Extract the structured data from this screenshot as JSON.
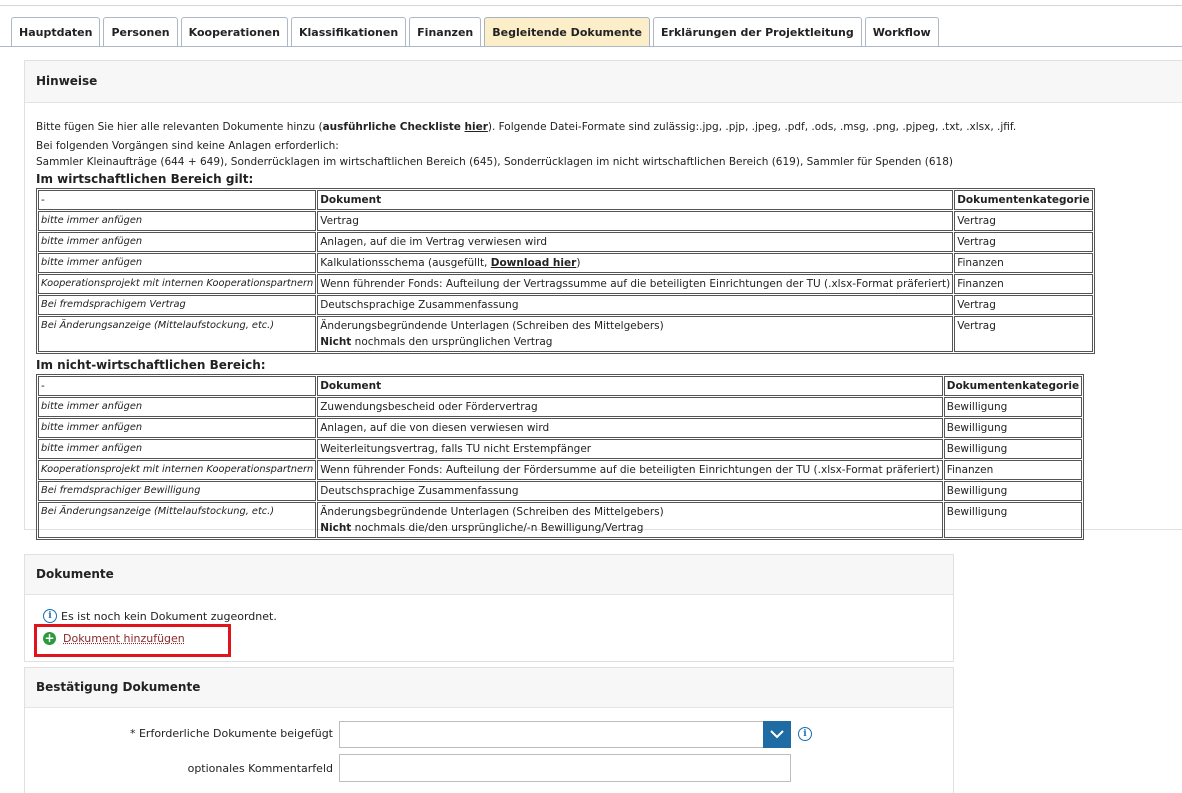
{
  "tabs": [
    {
      "label": "Hauptdaten"
    },
    {
      "label": "Personen"
    },
    {
      "label": "Kooperationen"
    },
    {
      "label": "Klassifikationen"
    },
    {
      "label": "Finanzen"
    },
    {
      "label": "Begleitende Dokumente",
      "active": true
    },
    {
      "label": "Erklärungen der Projektleitung"
    },
    {
      "label": "Workflow"
    }
  ],
  "hinweise": {
    "title": "Hinweise",
    "intro_pre": "Bitte fügen Sie hier alle relevanten Dokumente hinzu (",
    "intro_bold": "ausführliche Checkliste ",
    "intro_link": "hier",
    "intro_post": "). Folgende Datei-Formate sind zulässig:.jpg, .pjp, .jpeg, .pdf, .ods, .msg, .png, .pjpeg, .txt, .xlsx, .jfif.",
    "note_line1": "Bei folgenden Vorgängen sind keine Anlagen erforderlich:",
    "note_line2": "Sammler Kleinaufträge (644 + 649), Sonderrücklagen im wirtschaftlichen Bereich (645), Sonderrücklagen im nicht wirtschaftlichen Bereich (619), Sammler für Spenden (618)",
    "section1_title": "Im wirtschaftlichen Bereich gilt:",
    "section2_title": "Im nicht-wirtschaftlichen Bereich:",
    "table1": {
      "headers": [
        "-",
        "Dokument",
        "Dokumentenkategorie"
      ],
      "rows": [
        {
          "cond": "bitte immer anfügen",
          "doc": "Vertrag",
          "cat": "Vertrag"
        },
        {
          "cond": "bitte immer anfügen",
          "doc": "Anlagen, auf die im Vertrag verwiesen wird",
          "cat": "Vertrag"
        },
        {
          "cond": "bitte immer anfügen",
          "doc_pre": "Kalkulationsschema (ausgefüllt, ",
          "doc_link": "Download hier",
          "doc_post": ")",
          "cat": "Finanzen"
        },
        {
          "cond": "Kooperationsprojekt mit internen  Kooperationspartnern",
          "doc": "Wenn führender Fonds: Aufteilung der Vertragssumme auf die beteiligten Einrichtungen der TU (.xlsx-Format präferiert)",
          "cat": "Finanzen"
        },
        {
          "cond": "Bei fremdsprachigem Vertrag",
          "doc": "Deutschsprachige Zusammenfassung",
          "cat": "Vertrag"
        },
        {
          "cond": "Bei Änderungsanzeige (Mittelaufstockung, etc.)",
          "doc": "Änderungsbegründende Unterlagen (Schreiben des Mittelgebers)",
          "doc2_bold": "Nicht",
          "doc2_rest": " nochmals den ursprünglichen Vertrag",
          "cat": "Vertrag"
        }
      ]
    },
    "table2": {
      "headers": [
        "-",
        "Dokument",
        "Dokumentenkategorie"
      ],
      "rows": [
        {
          "cond": "bitte immer anfügen",
          "doc": "Zuwendungsbescheid oder Fördervertrag",
          "cat": "Bewilligung"
        },
        {
          "cond": "bitte immer anfügen",
          "doc": "Anlagen, auf die von diesen verwiesen wird",
          "cat": "Bewilligung"
        },
        {
          "cond": "bitte immer anfügen",
          "doc": "Weiterleitungsvertrag, falls TU nicht Erstempfänger",
          "cat": "Bewilligung"
        },
        {
          "cond": "Kooperationsprojekt mit internen Kooperationspartnern",
          "doc": "Wenn führender Fonds: Aufteilung der Fördersumme auf die beteiligten Einrichtungen der TU (.xlsx-Format präferiert)",
          "cat": "Finanzen"
        },
        {
          "cond": "Bei fremdsprachiger Bewilligung",
          "doc": "Deutschsprachige Zusammenfassung",
          "cat": "Bewilligung"
        },
        {
          "cond": "Bei Änderungsanzeige (Mittelaufstockung, etc.)",
          "doc": "Änderungsbegründende Unterlagen (Schreiben des Mittelgebers)",
          "doc2_bold": "Nicht",
          "doc2_rest": " nochmals die/den ursprüngliche/-n Bewilligung/Vertrag",
          "cat": "Bewilligung"
        }
      ]
    }
  },
  "dokumente": {
    "title": "Dokumente",
    "empty_message": "Es ist noch kein Dokument zugeordnet.",
    "add_label": "Dokument hinzufügen",
    "highlight_color": "#e1141c"
  },
  "bestaetigung": {
    "title": "Bestätigung Dokumente",
    "field1_label": "* Erforderliche Dokumente beigefügt",
    "field1_value": "",
    "field2_label": "optionales Kommentarfeld",
    "field2_value": ""
  },
  "colors": {
    "active_tab": "#fbeec9",
    "select_button": "#1f6ba3",
    "info_icon": "#1a6fb5",
    "add_icon": "#2a9a3a"
  }
}
